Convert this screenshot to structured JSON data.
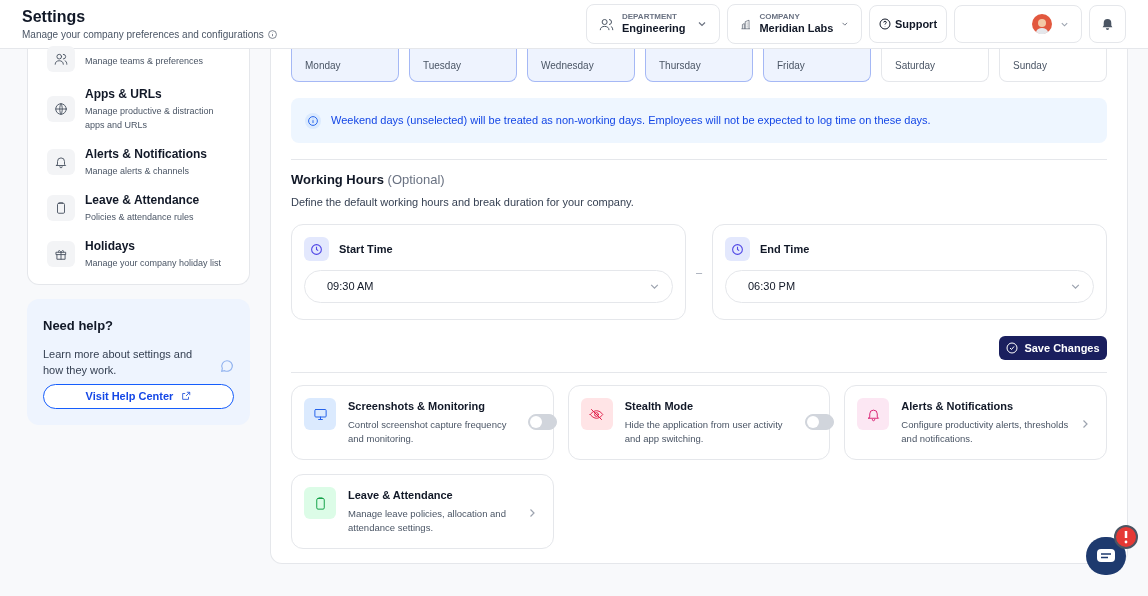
{
  "header": {
    "title": "Settings",
    "subtitle": "Manage your company preferences and configurations",
    "department": {
      "label": "DEPARTMENT",
      "value": "Engineering"
    },
    "company": {
      "label": "COMPANY",
      "value": "Meridian Labs"
    },
    "support": "Support"
  },
  "sidebar": {
    "items": [
      {
        "description": "Manage teams & preferences"
      },
      {
        "title": "Apps & URLs",
        "description": "Manage productive & distraction apps and URLs"
      },
      {
        "title": "Alerts & Notifications",
        "description": "Manage alerts & channels"
      },
      {
        "title": "Leave & Attendance",
        "description": "Policies & attendance rules"
      },
      {
        "title": "Holidays",
        "description": "Manage your company holiday list"
      }
    ]
  },
  "help": {
    "title": "Need help?",
    "text": "Learn more about settings and how they work.",
    "link": "Visit Help Center"
  },
  "days": [
    {
      "name": "Monday",
      "selected": true
    },
    {
      "name": "Tuesday",
      "selected": true
    },
    {
      "name": "Wednesday",
      "selected": true
    },
    {
      "name": "Thursday",
      "selected": true
    },
    {
      "name": "Friday",
      "selected": true
    },
    {
      "name": "Saturday",
      "selected": false
    },
    {
      "name": "Sunday",
      "selected": false
    }
  ],
  "info": "Weekend days (unselected) will be treated as non-working days. Employees will not be expected to log time on these days.",
  "working_hours": {
    "title": "Working Hours",
    "optional": "(Optional)",
    "description": "Define the default working hours and break duration for your company.",
    "start": {
      "label": "Start Time",
      "value": "09:30 AM"
    },
    "separator": "–",
    "end": {
      "label": "End Time",
      "value": "06:30 PM"
    },
    "save": "Save Changes"
  },
  "features": [
    {
      "kind": "toggle",
      "title": "Screenshots & Monitoring",
      "description": "Control screenshot capture frequency and monitoring.",
      "on": false
    },
    {
      "kind": "toggle",
      "title": "Stealth Mode",
      "description": "Hide the application from user activity and app switching.",
      "on": false
    },
    {
      "kind": "link",
      "title": "Alerts & Notifications",
      "description": "Configure productivity alerts, thresholds and notifications."
    },
    {
      "kind": "link",
      "title": "Leave & Attendance",
      "description": "Manage leave policies, allocation and attendance settings."
    }
  ]
}
